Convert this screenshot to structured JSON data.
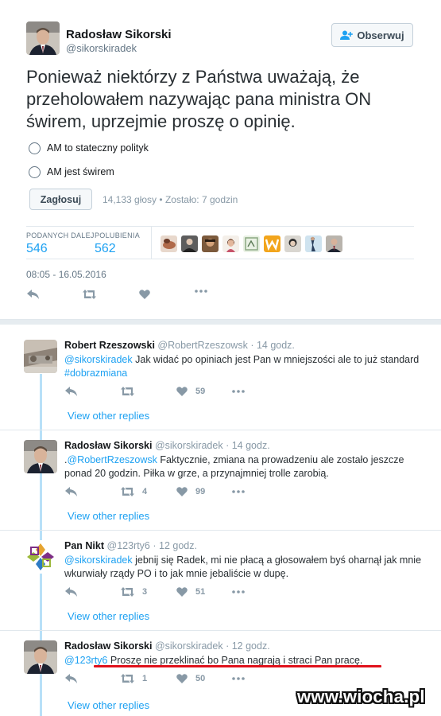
{
  "colors": {
    "accent": "#1da1f2",
    "muted": "#8899a6",
    "underline": "#e0121b"
  },
  "tweet": {
    "author_name": "Radosław Sikorski",
    "author_handle": "@sikorskiradek",
    "follow_label": "Obserwuj",
    "text": "Ponieważ niektórzy z Państwa uważają, że przeholowałem nazywając pana ministra ON świrem, uprzejmie proszę o opinię.",
    "poll": {
      "options": [
        "AM to stateczny polityk",
        "AM jest świrem"
      ],
      "vote_label": "Zagłosuj",
      "votes": "14,133 głosy",
      "remaining": "Zostało: 7 godzin"
    },
    "stats": {
      "retweets_label": "PODANYCH DALEJ",
      "retweets": "546",
      "likes_label": "POLUBIENIA",
      "likes": "562"
    },
    "timestamp": "08:05 - 16.05.2016"
  },
  "replies": [
    {
      "name": "Robert Rzeszowski",
      "handle": "@RobertRzeszowsk",
      "time": "14 godz.",
      "mention": "@sikorskiradek",
      "text": " Jak widać po opiniach jest Pan w mniejszości ale to już standard",
      "hashtag": "#dobrazmiana",
      "retweets": "",
      "likes": "59",
      "view_replies": "View other replies"
    },
    {
      "name": "Radosław Sikorski",
      "handle": "@sikorskiradek",
      "time": "14 godz.",
      "prefix": ".",
      "mention": "@RobertRzeszowsk",
      "text": " Faktycznie,  zmiana na prowadzeniu ale zostało jeszcze ponad 20 godzin. Piłka w grze,  a przynajmniej trolle zarobią.",
      "retweets": "4",
      "likes": "99",
      "view_replies": "View other replies"
    },
    {
      "name": "Pan Nikt",
      "handle": "@123rty6",
      "time": "12 godz.",
      "mention": "@sikorskiradek",
      "text": " jebnij się Radek, mi nie płacą a głosowałem byś oharnął jak mnie wkurwiały rządy PO i to jak mnie jebaliście w dupę.",
      "retweets": "3",
      "likes": "51",
      "view_replies": "View other replies"
    },
    {
      "name": "Radosław Sikorski",
      "handle": "@sikorskiradek",
      "time": "12 godz.",
      "mention": "@123rty6",
      "text": " Proszę nie przeklinać bo Pana nagrają i straci Pan pracę.",
      "retweets": "1",
      "likes": "50",
      "view_replies": "View other replies"
    }
  ],
  "watermark": "www.wiocha.pl"
}
